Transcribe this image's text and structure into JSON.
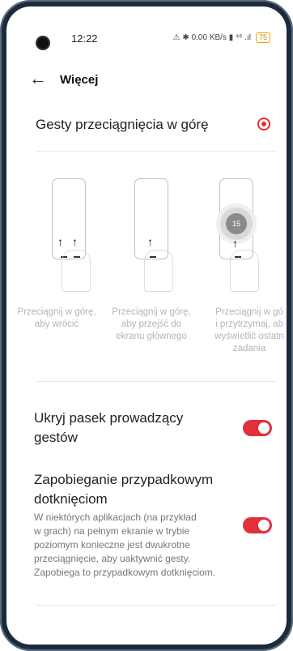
{
  "status_bar": {
    "time": "12:22",
    "icons": "⚠ ✱ 0.00 KB/s ▮ ⁴⁶ .ıl",
    "battery": "75"
  },
  "header": {
    "back_icon": "arrow-left-icon",
    "title": "Więcej"
  },
  "gestures": {
    "label": "Gesty przeciągnięcia w górę",
    "selected": true,
    "accent": "#e22f3a",
    "illustrations": [
      {
        "caption_line1": "Przeciągnij w górę,",
        "caption_line2": "aby wrócić",
        "caption_line3": "",
        "caption_line4": ""
      },
      {
        "caption_line1": "Przeciągnij w górę,",
        "caption_line2": "aby przejść do",
        "caption_line3": "ekranu głównego",
        "caption_line4": ""
      },
      {
        "caption_line1": "Przeciągnij w gó",
        "caption_line2": "i przytrzymaj, ab",
        "caption_line3": "wyświetlić ostatn",
        "caption_line4": "zadania"
      }
    ],
    "recents_bubble": "15"
  },
  "hide_bar": {
    "title_line1": "Ukryj pasek prowadzący",
    "title_line2": "gestów",
    "enabled": true
  },
  "prevent_touch": {
    "title_line1": "Zapobieganie przypadkowym",
    "title_line2": "dotknięciom",
    "desc_line1": "W niektórych aplikacjach (na przykład",
    "desc_line2": "w grach) na pełnym ekranie w trybie",
    "desc_line3": "poziomym konieczne jest dwukrotne",
    "desc_line4": "przeciągnięcie, aby uaktywnić gesty.",
    "desc_line5": "Zapobiega to przypadkowym dotknięciom.",
    "enabled": true
  }
}
